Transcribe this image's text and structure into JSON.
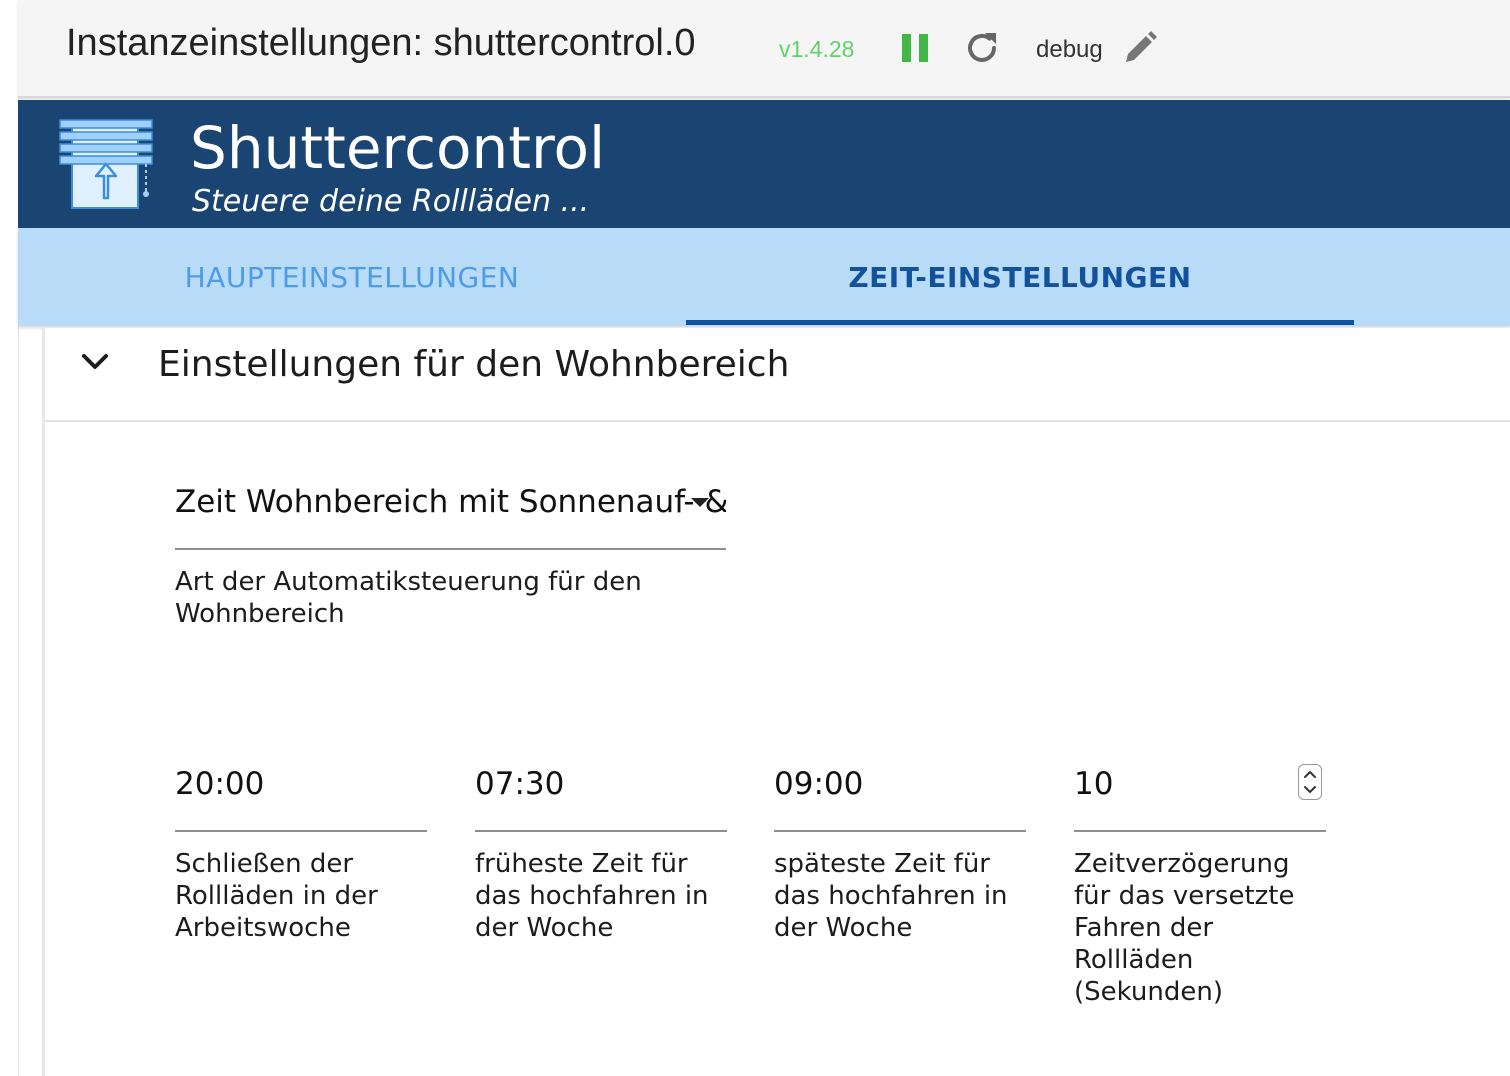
{
  "topbar": {
    "title": "Instanzeinstellungen: shuttercontrol.0",
    "version": "v1.4.28",
    "loglevel": "debug"
  },
  "header": {
    "app_name": "Shuttercontrol",
    "subtitle": "Steuere deine Rollläden ..."
  },
  "tabs": [
    {
      "label": "HAUPTEINSTELLUNGEN",
      "active": false
    },
    {
      "label": "ZEIT-EINSTELLUNGEN",
      "active": true
    }
  ],
  "section": {
    "title": "Einstellungen für den Wohnbereich",
    "select": {
      "value": "Zeit Wohnbereich mit Sonnenauf- & Sonnenuntergang",
      "label": "Art der Automatiksteuerung für den Wohnbereich"
    },
    "fields": [
      {
        "value": "20:00",
        "label": "Schließen der Rollläden in der Arbeitswoche"
      },
      {
        "value": "07:30",
        "label": "früheste Zeit für das hochfahren in der Woche"
      },
      {
        "value": "09:00",
        "label": "späteste Zeit für das hochfahren in der Woche"
      },
      {
        "value": "10",
        "label": "Zeitverzögerung für das versetzte Fahren der Rollläden (Sekunden)"
      }
    ]
  },
  "colors": {
    "header_bg": "#1a4573",
    "tabbar_bg": "#b8dcf8",
    "active_tab": "#12519c",
    "inactive_tab": "#4c9ce8",
    "version_green": "#5fd26a"
  },
  "icons": [
    "pause-icon",
    "refresh-icon",
    "edit-icon",
    "shutter-logo-icon",
    "chevron-down-icon",
    "spinner-up-icon",
    "spinner-down-icon"
  ]
}
